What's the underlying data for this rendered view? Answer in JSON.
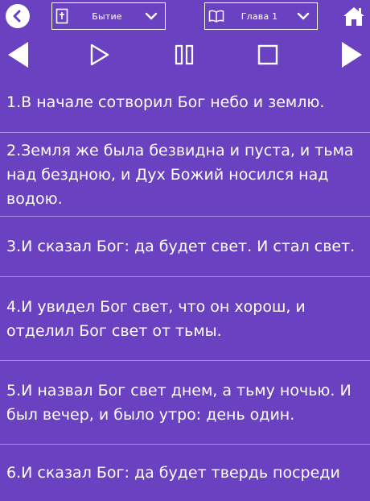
{
  "toolbar": {
    "book_select": {
      "label": "Бытие"
    },
    "chapter_select": {
      "label": "Глава 1"
    }
  },
  "verses": [
    "1.В начале сотворил Бог небо и землю.",
    "2.Земля же была безвидна и пуста, и тьма над бездною, и Дух Божий носился над водою.",
    "3.И сказал Бог: да будет свет. И стал свет.",
    "4.И увидел Бог свет, что он хорош, и отделил Бог свет от тьмы.",
    "5.И назвал Бог свет днем, а тьму ночью. И был вечер, и было утро: день один.",
    "6.И сказал Бог: да будет твердь посреди"
  ],
  "colors": {
    "background": "#6a42c1",
    "text": "#ffffff",
    "divider": "#a890dc"
  },
  "icons": [
    "back-arrow-icon",
    "bible-icon",
    "open-book-icon",
    "chevron-down-icon",
    "home-icon",
    "previous-icon",
    "play-icon",
    "pause-icon",
    "stop-icon",
    "next-icon"
  ]
}
